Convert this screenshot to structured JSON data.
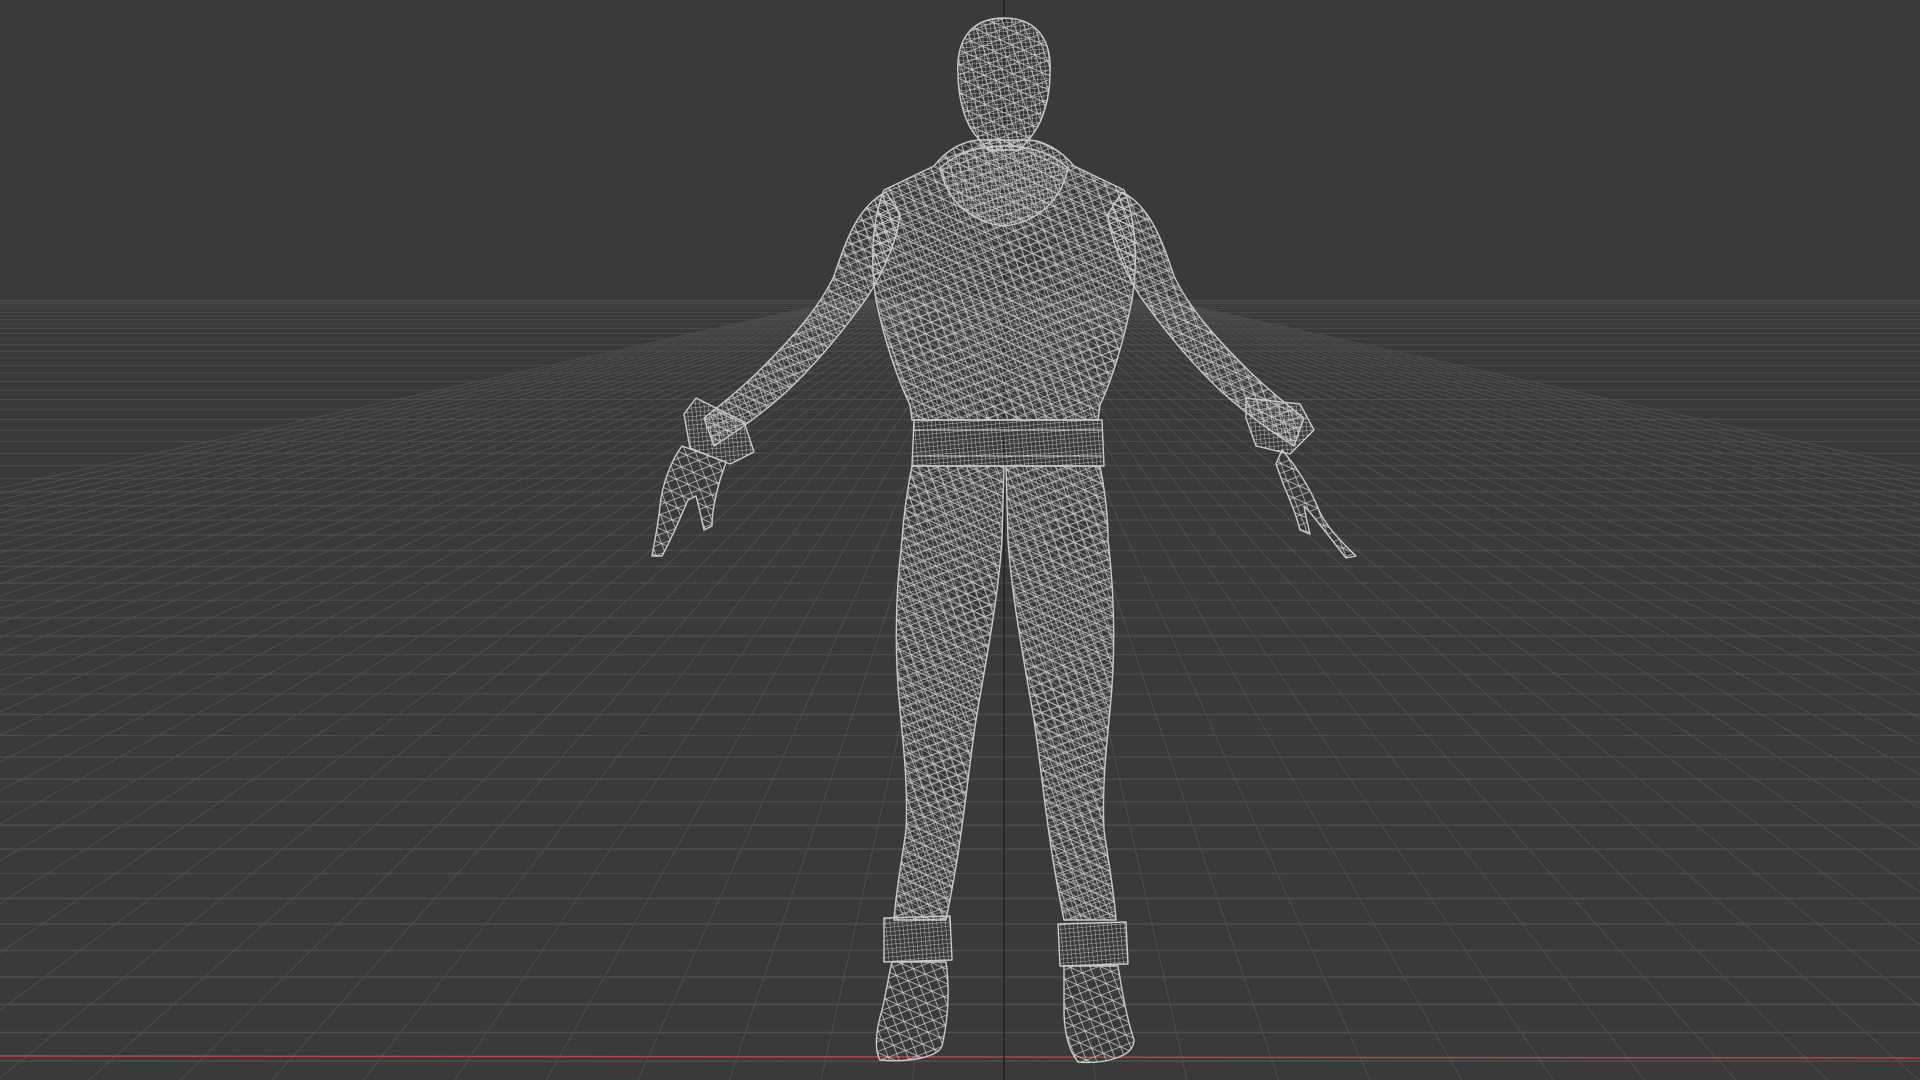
{
  "viewport": {
    "mode": "wireframe",
    "view": "front-orthographic",
    "grid": true,
    "colors": {
      "background": "#3a3a3a",
      "grid_line": "#4e4e4e",
      "x_axis": "#b3444f",
      "z_axis": "#232323",
      "wire": "#c6c6c6"
    }
  },
  "model": {
    "name_icon": "humanoid-wireframe-mesh",
    "pose": "A-pose"
  }
}
